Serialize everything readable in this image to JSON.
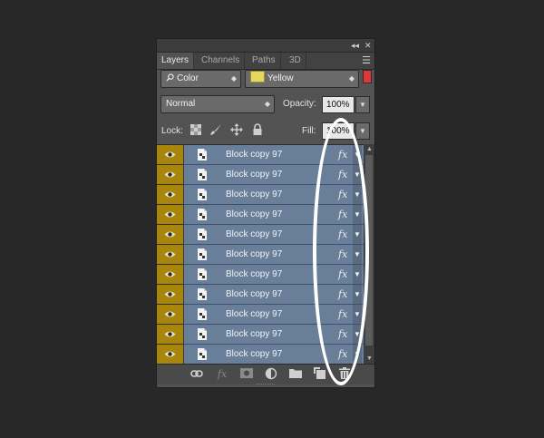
{
  "panel": {
    "titlebar": {
      "collapse_icon": "double-chevron-left-icon",
      "close_icon": "close-icon"
    },
    "tabs": [
      {
        "label": "Layers",
        "active": true
      },
      {
        "label": "Channels",
        "active": false
      },
      {
        "label": "Paths",
        "active": false
      },
      {
        "label": "3D",
        "active": false
      }
    ],
    "menu_icon": "panel-menu-icon",
    "filter": {
      "kind_icon": "search-icon",
      "kind_value": "Color",
      "color_value": "Yellow",
      "color_swatch": "#e7d75c",
      "toggle_color": "#e03838"
    },
    "blend": {
      "mode_value": "Normal",
      "opacity_label": "Opacity:",
      "opacity_value": "100%"
    },
    "lock": {
      "label": "Lock:",
      "fill_label": "Fill:",
      "fill_value": "100%"
    },
    "layers": [
      {
        "name": "Block copy 97",
        "fx": "fx"
      },
      {
        "name": "Block copy 97",
        "fx": "fx"
      },
      {
        "name": "Block copy 97",
        "fx": "fx"
      },
      {
        "name": "Block copy 97",
        "fx": "fx"
      },
      {
        "name": "Block copy 97",
        "fx": "fx"
      },
      {
        "name": "Block copy 97",
        "fx": "fx"
      },
      {
        "name": "Block copy 97",
        "fx": "fx"
      },
      {
        "name": "Block copy 97",
        "fx": "fx"
      },
      {
        "name": "Block copy 97",
        "fx": "fx"
      },
      {
        "name": "Block copy 97",
        "fx": "fx"
      },
      {
        "name": "Block copy 97",
        "fx": "fx"
      }
    ],
    "bottom_icons": [
      "link-icon",
      "fx-icon",
      "mask-icon",
      "adjustment-icon",
      "folder-icon",
      "new-layer-icon",
      "trash-icon"
    ],
    "bottom_fx_label": "fx",
    "colors": {
      "eye_tag": "#a8860c",
      "row_selected": "#697e99",
      "highlight": "#ffffff"
    }
  }
}
